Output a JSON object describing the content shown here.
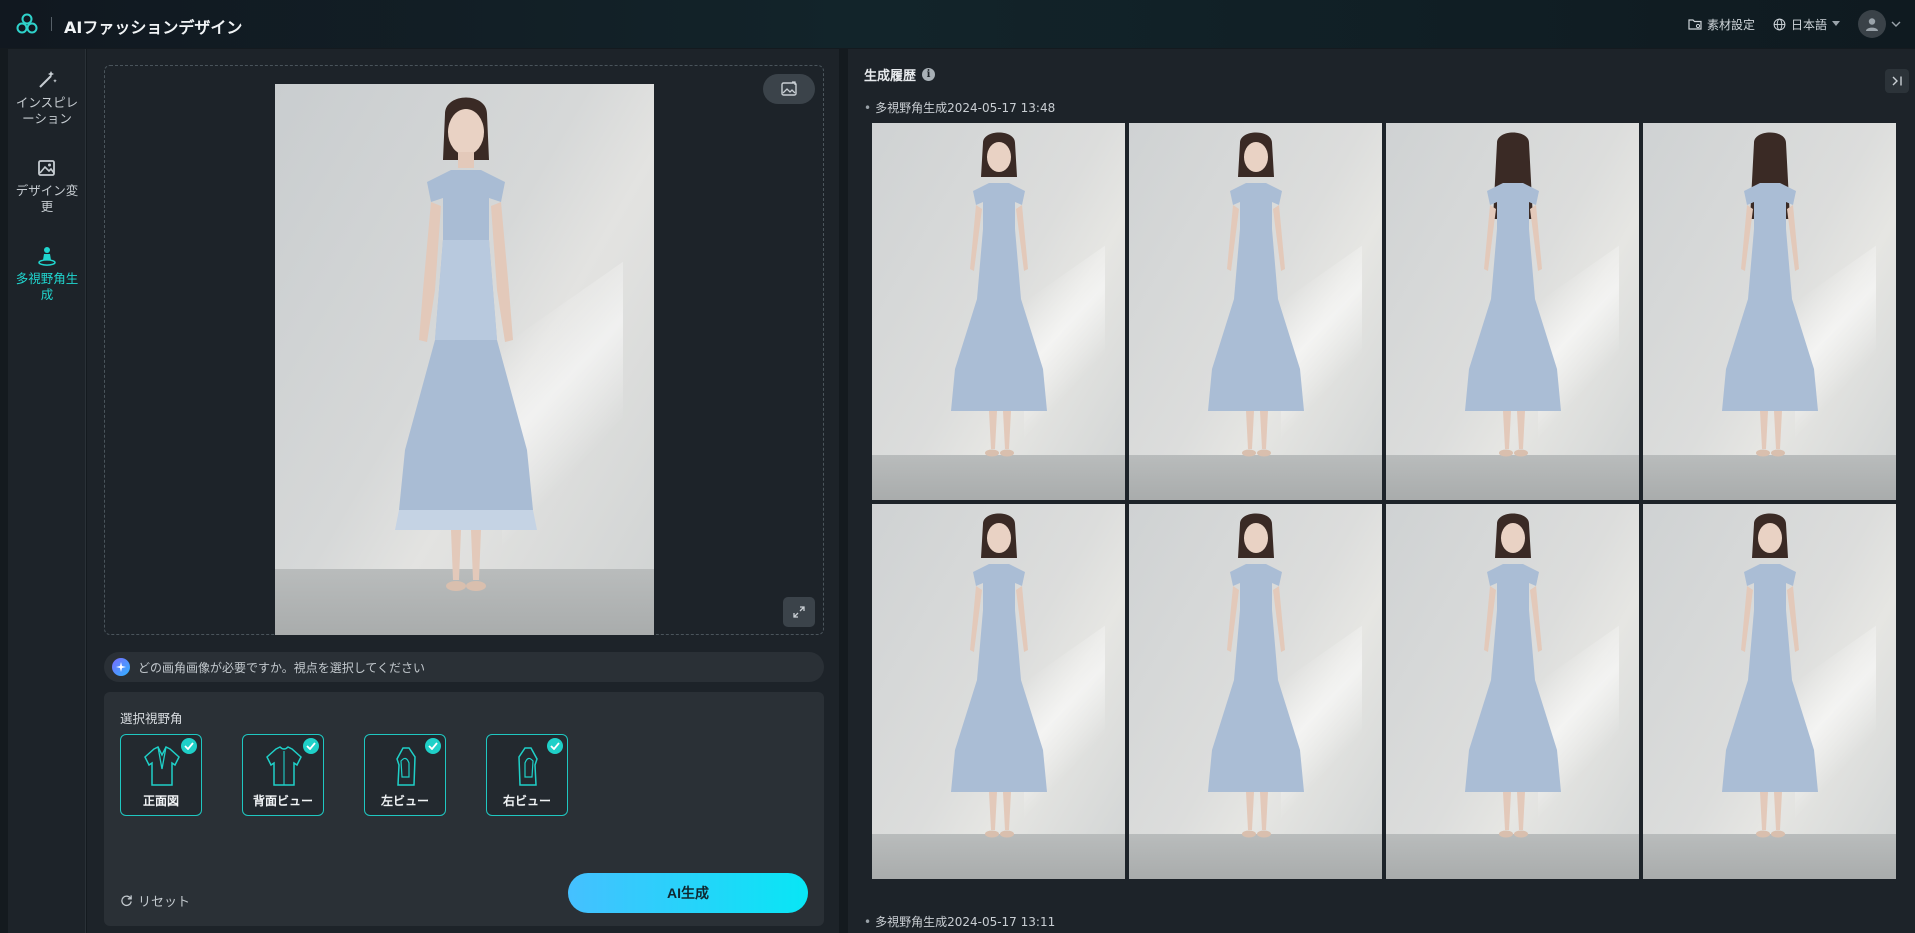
{
  "app": {
    "title": "AIファッションデザイン",
    "materials_label": "素材設定",
    "language_label": "日本語"
  },
  "sidebar": {
    "items": [
      {
        "label": "インスピレーション",
        "icon": "magic-wand-icon",
        "active": false
      },
      {
        "label": "デザイン変更",
        "icon": "image-edit-icon",
        "active": false
      },
      {
        "label": "多視野角生成",
        "icon": "multi-view-person-icon",
        "active": true
      }
    ]
  },
  "editor": {
    "hint": "どの画角画像が必要ですか。視点を選択してください",
    "select_title": "選択視野角",
    "views": [
      {
        "label": "正面図",
        "icon": "front-view-garment-icon",
        "checked": true
      },
      {
        "label": "背面ビュー",
        "icon": "back-view-garment-icon",
        "checked": true
      },
      {
        "label": "左ビュー",
        "icon": "left-view-garment-icon",
        "checked": true
      },
      {
        "label": "右ビュー",
        "icon": "right-view-garment-icon",
        "checked": true
      }
    ],
    "reset_label": "リセット",
    "generate_label": "AI生成"
  },
  "history": {
    "title": "生成履歴",
    "groups": [
      {
        "label": "多視野角生成2024-05-17 13:48"
      },
      {
        "label": "多視野角生成2024-05-17 13:11"
      }
    ]
  },
  "colors": {
    "accent": "#1fc7c1",
    "generate_gradient_start": "#45c0ff",
    "generate_gradient_end": "#08e6f5",
    "background": "#141a1f",
    "panel": "#1d2329"
  }
}
